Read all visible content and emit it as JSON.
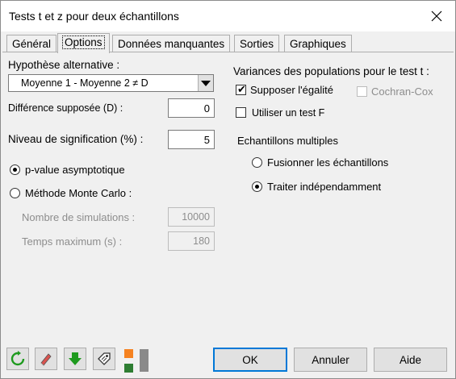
{
  "window": {
    "title": "Tests t et z pour deux échantillons",
    "close_glyph": "✕"
  },
  "tabs": [
    {
      "label": "Général",
      "active": false
    },
    {
      "label": "Options",
      "active": true
    },
    {
      "label": "Données manquantes",
      "active": false
    },
    {
      "label": "Sorties",
      "active": false
    },
    {
      "label": "Graphiques",
      "active": false
    }
  ],
  "options": {
    "alt_hypothesis_label": "Hypothèse alternative :",
    "alt_hypothesis_value": "Moyenne 1 - Moyenne 2 ≠ D",
    "diff_label": "Différence supposée (D) :",
    "diff_value": "0",
    "signif_label": "Niveau de signification (%) :",
    "signif_value": "5",
    "pvalue_asym_label": "p-value asymptotique",
    "monte_carlo_label": "Méthode Monte Carlo :",
    "nb_sim_label": "Nombre de simulations :",
    "nb_sim_value": "10000",
    "max_time_label": "Temps maximum (s) :",
    "max_time_value": "180",
    "variances_label": "Variances des populations pour le test t :",
    "equal_var_label": "Supposer l'égalité",
    "cochran_label": "Cochran-Cox",
    "ftest_label": "Utiliser un test F",
    "multi_samples_label": "Echantillons multiples",
    "merge_label": "Fusionner les échantillons",
    "independent_label": "Traiter indépendamment"
  },
  "state": {
    "pvalue_method": "asymptotique",
    "equal_variance": true,
    "cochran_cox": false,
    "use_f_test": false,
    "multi_samples": "independent"
  },
  "footer": {
    "ok": "OK",
    "cancel": "Annuler",
    "help": "Aide",
    "icons": [
      "reset-icon",
      "eraser-icon",
      "download-arrow-icon",
      "tag-icon",
      "color-swatch-icon"
    ]
  },
  "colors": {
    "accent": "#0078d7",
    "green_icon": "#1e9a1e",
    "orange_swatch": "#f58220",
    "green_swatch": "#2e7d32"
  }
}
